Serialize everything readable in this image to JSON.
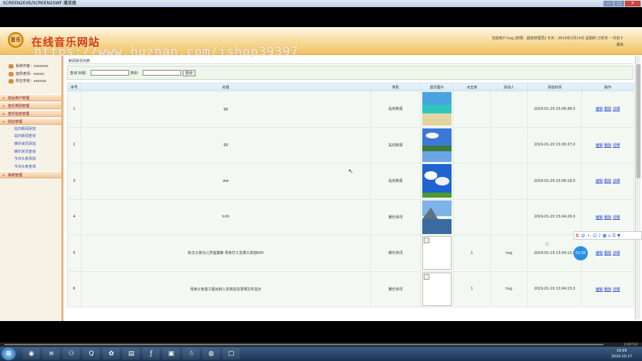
{
  "window": {
    "title": "SCREEN2EXE/SCREEN2SWF 播放器",
    "minimize": "—",
    "maximize": "□",
    "close": "✕"
  },
  "header": {
    "site_title": "在线音乐网站",
    "logo_text": "音乐",
    "watermark": "https://www.huzhan.com/ishop39397",
    "user_line": "当前用户:hsg [权限：超级管理员] 今天：2019年2月14日 星期四 己亥年 一月初十",
    "logout": "退出"
  },
  "sidebar": {
    "info": [
      {
        "label": "系统作者：xxxxxxx"
      },
      {
        "label": "指导老师：xxxxx"
      },
      {
        "label": "所在学校：xxxxxx"
      }
    ],
    "menu": [
      {
        "label": "前台用户管理"
      },
      {
        "label": "音乐类别管理"
      },
      {
        "label": "音乐信息管理"
      },
      {
        "label": "前台管理"
      }
    ],
    "submenu": [
      "站内新闻添加",
      "站内新闻查询",
      "娱乐资讯添加",
      "娱乐资讯查询",
      "今日头条添加",
      "今日头条查询"
    ],
    "last_menu": "系统管理"
  },
  "main": {
    "crumb": "新闻资讯列表",
    "search": {
      "title_label": "查询 标题：",
      "type_label": "类别：",
      "button": "查询"
    },
    "columns": [
      "序号",
      "标题",
      "类别",
      "首页图片",
      "点击率",
      "添加人",
      "添加时间",
      "操作"
    ],
    "rows": [
      {
        "no": "1",
        "title": "gg",
        "type": "站内新闻",
        "img": "beach",
        "clicks": "",
        "adder": "",
        "time": "2019-01-20 15:06:48.0"
      },
      {
        "no": "2",
        "title": "gg",
        "type": "站内新闻",
        "img": "lake",
        "clicks": "",
        "adder": "",
        "time": "2019-01-20 15:06:37.0"
      },
      {
        "no": "3",
        "title": "ww",
        "type": "站内新闻",
        "img": "sky",
        "clicks": "",
        "adder": "",
        "time": "2019-01-20 15:06:18.0"
      },
      {
        "no": "4",
        "title": "hrth",
        "type": "娱乐资讯",
        "img": "mountain",
        "clicks": "",
        "adder": "",
        "time": "2019-01-20 15:04:26.0"
      },
      {
        "no": "5",
        "title": "秋文父亲为儿学篮摸索 母亲打工支撑工资但600",
        "type": "娱乐资讯",
        "img": "broken",
        "clicks": "1",
        "adder": "hsg",
        "time": "2019-01-19 13:04:15.0"
      },
      {
        "no": "6",
        "title": "母亲父亲患工程出转入实效信息发明文件显示",
        "type": "娱乐资讯",
        "img": "broken",
        "clicks": "1",
        "adder": "hsg",
        "time": "2019-01-19 13:04:15.0"
      }
    ],
    "ops": [
      "编辑",
      "删除",
      "详细"
    ]
  },
  "ime": {
    "logo": "S",
    "lang": "中",
    "icons": "•, ☺ ♪ ▦ ⌂ ☰ ▼"
  },
  "timer": "02:56",
  "player": {
    "time": "2:16/7:42"
  },
  "taskbar": {
    "icons": [
      "◉",
      "≡",
      "⚇",
      "Q",
      "✿",
      "▤",
      "ƒ",
      "▣",
      "☃",
      "◍",
      "▢"
    ],
    "tray": [
      "▲",
      "⚑",
      "◐",
      "♪",
      "♥",
      "◆",
      "◀",
      "▶"
    ],
    "time": "19:09",
    "date": "2020-10-17"
  },
  "colors": {
    "header_gold": "#efc360",
    "site_title": "#d23a1c",
    "link": "#1a3fd1",
    "row_bg": "#f3f8f3"
  }
}
